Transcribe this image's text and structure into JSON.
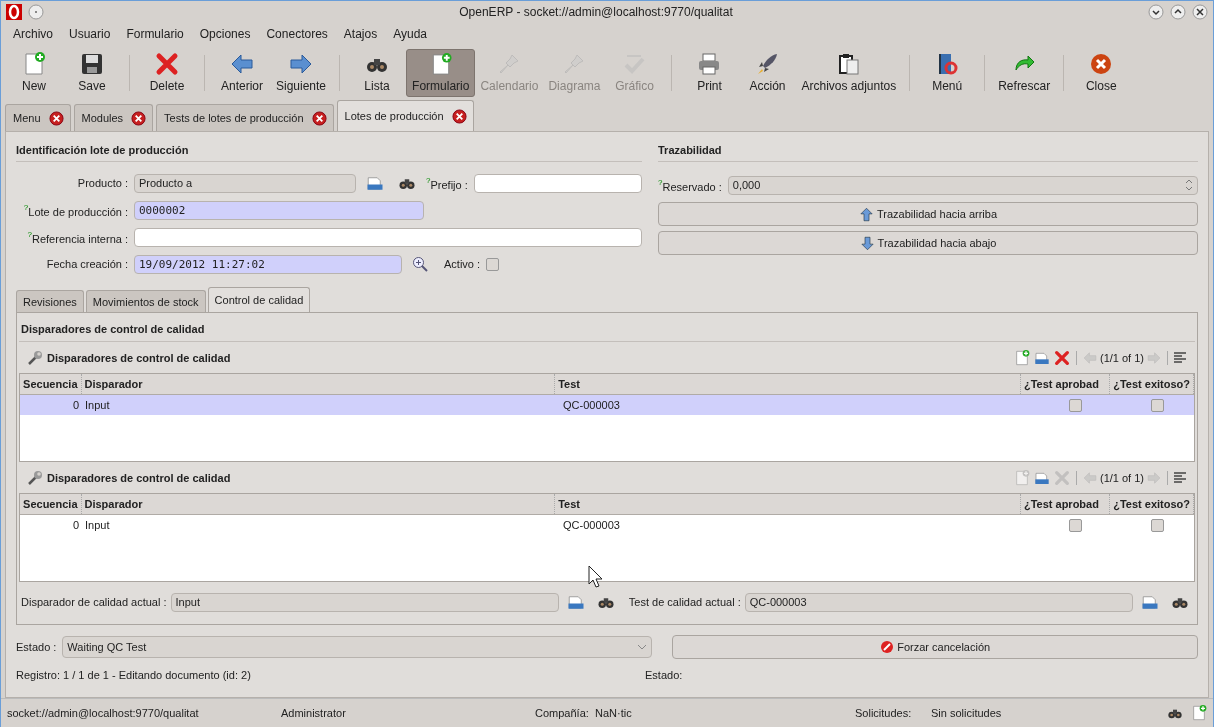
{
  "window": {
    "title": "OpenERP - socket://admin@localhost:9770/qualitat"
  },
  "menu": [
    {
      "label": "Archivo"
    },
    {
      "label": "Usuario"
    },
    {
      "label": "Formulario"
    },
    {
      "label": "Opciones"
    },
    {
      "label": "Conectores"
    },
    {
      "label": "Atajos"
    },
    {
      "label": "Ayuda"
    }
  ],
  "toolbar_groups": [
    {
      "items": [
        {
          "label": "New",
          "kind": "new",
          "disabled": false,
          "selected": false
        },
        {
          "label": "Save",
          "kind": "save",
          "disabled": false,
          "selected": false
        }
      ]
    },
    {
      "items": [
        {
          "label": "Delete",
          "kind": "delete",
          "disabled": false,
          "selected": false
        }
      ]
    },
    {
      "items": [
        {
          "label": "Anterior",
          "kind": "back",
          "disabled": false,
          "selected": false
        },
        {
          "label": "Siguiente",
          "kind": "forward",
          "disabled": false,
          "selected": false
        }
      ]
    },
    {
      "items": [
        {
          "label": "Lista",
          "kind": "binoculars",
          "disabled": false,
          "selected": false
        },
        {
          "label": "Formulario",
          "kind": "new",
          "disabled": false,
          "selected": true
        },
        {
          "label": "Calendario",
          "kind": "pin",
          "disabled": true,
          "selected": false
        },
        {
          "label": "Diagrama",
          "kind": "pin",
          "disabled": true,
          "selected": false
        },
        {
          "label": "Gráfico",
          "kind": "check",
          "disabled": true,
          "selected": false
        }
      ]
    },
    {
      "items": [
        {
          "label": "Print",
          "kind": "print",
          "disabled": false,
          "selected": false
        },
        {
          "label": "Acción",
          "kind": "rocket",
          "disabled": false,
          "selected": false
        },
        {
          "label": "Archivos adjuntos",
          "kind": "clipboard",
          "disabled": false,
          "selected": false
        }
      ]
    },
    {
      "items": [
        {
          "label": "Menú",
          "kind": "book",
          "disabled": false,
          "selected": false
        }
      ]
    },
    {
      "items": [
        {
          "label": "Refrescar",
          "kind": "refresh",
          "disabled": false,
          "selected": false
        }
      ]
    },
    {
      "items": [
        {
          "label": "Close",
          "kind": "close",
          "disabled": false,
          "selected": false
        }
      ]
    }
  ],
  "tabs": [
    {
      "label": "Menu",
      "selected": false
    },
    {
      "label": "Modules",
      "selected": false
    },
    {
      "label": "Tests de lotes de producción",
      "selected": false
    },
    {
      "label": "Lotes de producción",
      "selected": true
    }
  ],
  "identification": {
    "title": "Identificación lote de producción",
    "producto": {
      "label": "Producto :",
      "value": "Producto a",
      "kind": "readonly"
    },
    "prefijo": {
      "label": "$^{?}$Prefijo :",
      "kind": "normal"
    },
    "lote": {
      "label": "$^{?}$Lote de producción :",
      "value": "0000002",
      "kind": "required"
    },
    "referencia": {
      "label": "$^{?}$Referencia interna :",
      "kind": "normal"
    },
    "fecha": {
      "label": "Fecha creación :",
      "value": "19/09/2012 11:27:02",
      "kind": "required"
    },
    "activo": {
      "label": "Activo :",
      "checked": false
    }
  },
  "trazabilidad": {
    "title": "Trazabilidad",
    "reservado": {
      "label": "$^{?}$Reservado :",
      "value": "0,000"
    },
    "buttons": [
      {
        "label": "Trazabilidad hacia arriba",
        "kind": "up"
      },
      {
        "label": "Trazabilidad hacia abajo",
        "kind": "down"
      }
    ]
  },
  "subtabs": [
    {
      "label": "Revisiones",
      "selected": false
    },
    {
      "label": "Movimientos de stock",
      "selected": false
    },
    {
      "label": "Control de calidad",
      "selected": true
    }
  ],
  "quality": {
    "title": "Disparadores de control de calidad",
    "grids": [
      {
        "title": "Disparadores de control de calidad",
        "pager": "(1/1 of 1)",
        "buttons": [
          {
            "kind": "new",
            "disabled": false
          },
          {
            "kind": "edit",
            "disabled": false
          },
          {
            "kind": "delete",
            "disabled": false
          }
        ],
        "columns": [
          "Secuencia",
          "Disparador",
          "Test",
          "¿Test aprobad",
          "¿Test exitoso?"
        ],
        "rows": [
          {
            "cells": [
              "0",
              "Input",
              "QC-000003"
            ],
            "aprobado": false,
            "exitoso": false,
            "selected": true
          }
        ]
      },
      {
        "title": "Disparadores de control de calidad",
        "pager": "(1/1 of 1)",
        "buttons": [
          {
            "kind": "new",
            "disabled": true
          },
          {
            "kind": "edit",
            "disabled": false
          },
          {
            "kind": "delete",
            "disabled": true
          }
        ],
        "columns": [
          "Secuencia",
          "Disparador",
          "Test",
          "¿Test aprobad",
          "¿Test exitoso?"
        ],
        "rows": [
          {
            "cells": [
              "0",
              "Input",
              "QC-000003"
            ],
            "aprobado": false,
            "exitoso": false,
            "selected": false
          }
        ]
      }
    ],
    "current_trigger": {
      "label": "Disparador de calidad actual :",
      "value": "Input"
    },
    "current_test": {
      "label": "Test de calidad actual :",
      "value": "QC-000003"
    }
  },
  "estado": {
    "label": "Estado :",
    "value": "Waiting QC Test"
  },
  "cancel_button": {
    "label": "Forzar cancelación"
  },
  "record_status": "Registro: 1 / 1 de 1 - Editando documento (id: 2)",
  "state_label": "Estado:",
  "status_bar": {
    "url": "socket://admin@localhost:9770/qualitat",
    "user": "Administrator",
    "company_label": "Compañía:",
    "company": "NaN·tic",
    "requests_label": "Solicitudes:",
    "requests": "Sin solicitudes"
  }
}
